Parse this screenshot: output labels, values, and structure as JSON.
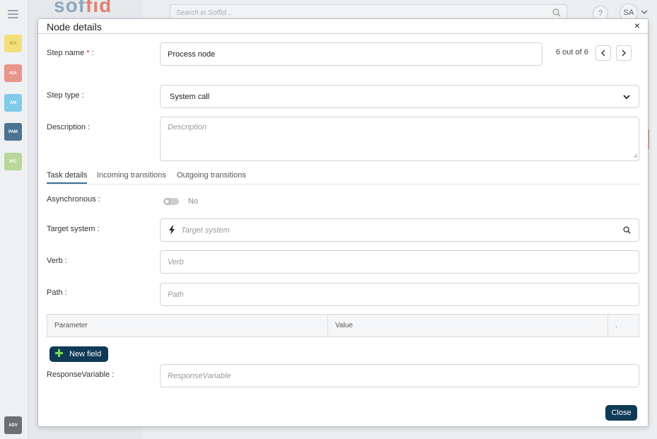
{
  "app": {
    "logo_text": "soffid",
    "search_placeholder": "Search in Soffid...",
    "help_label": "?",
    "user_initials": "SA",
    "modules": [
      {
        "label": "IGS",
        "color": "#f3df7a"
      },
      {
        "label": "IGA",
        "color": "#e8958a"
      },
      {
        "label": "AM",
        "color": "#7fcbe8"
      },
      {
        "label": "PAM",
        "color": "#4a7492"
      },
      {
        "label": "IRC",
        "color": "#b9d79a"
      },
      {
        "label": "ADV",
        "color": "#6d6f73"
      }
    ]
  },
  "modal": {
    "title": "Node details",
    "close_icon": "×",
    "pager_text": "6 out of 6",
    "step_name": {
      "label": "Step name",
      "required_mark": "*",
      "colon": " :",
      "value": "Process node"
    },
    "step_type": {
      "label": "Step type :",
      "value": "System call"
    },
    "description": {
      "label": "Description :",
      "placeholder": "Description"
    },
    "tabs": [
      "Task details",
      "Incoming transitions",
      "Outgoing transitions"
    ],
    "asynchronous": {
      "label": "Asynchronous :",
      "value_text": "No",
      "enabled": false
    },
    "target_system": {
      "label": "Target system :",
      "placeholder": "Target system"
    },
    "verb": {
      "label": "Verb :",
      "placeholder": "Verb"
    },
    "path": {
      "label": "Path :",
      "placeholder": "Path"
    },
    "grid": {
      "columns": [
        "Parameter",
        "Value",
        "."
      ]
    },
    "new_field_label": "New field",
    "response_variable": {
      "label": "ResponseVariable :",
      "placeholder": "ResponseVariable"
    },
    "close_button_label": "Close"
  }
}
